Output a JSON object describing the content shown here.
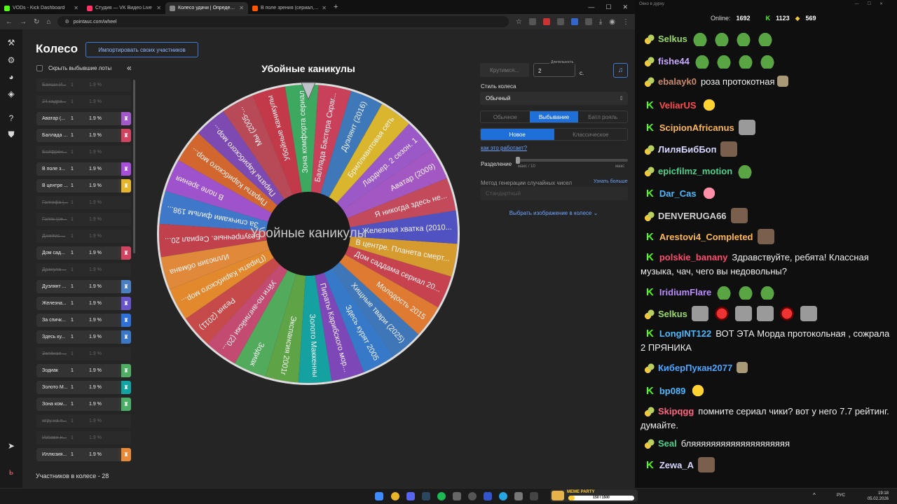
{
  "browser": {
    "tabs": [
      {
        "title": "VODs - Kick Dashboard",
        "color": "#53fc18",
        "active": false
      },
      {
        "title": "Студия — VK Видео Live",
        "color": "#ff3366",
        "active": false
      },
      {
        "title": "Колесо удачи | Определите п",
        "color": "#555555",
        "active": true
      },
      {
        "title": "В поле зрения (сериал, 1-5 се",
        "color": "#ff5500",
        "active": false
      }
    ],
    "new_tab": "+",
    "url": "pointauc.com/wheel"
  },
  "page": {
    "title": "Колесо",
    "import_label": "Импортировать своих участников",
    "hide_label": "Скрыть выбывшие лоты",
    "collapse_icon": "«",
    "count_label": "Участников в колесе - 28",
    "lots": [
      {
        "name": "Банши И...",
        "amount": "1",
        "percent": "1.9 %",
        "out": true,
        "color": ""
      },
      {
        "name": "24 кадра...",
        "amount": "1",
        "percent": "1.9 %",
        "out": true,
        "color": ""
      },
      {
        "name": "Аватар (...",
        "amount": "1",
        "percent": "1.9 %",
        "out": false,
        "color": "#a459c9"
      },
      {
        "name": "Баллада ...",
        "amount": "1",
        "percent": "1.9 %",
        "out": false,
        "color": "#d0445f"
      },
      {
        "name": "Бойфрен...",
        "amount": "1",
        "percent": "1.9 %",
        "out": true,
        "color": ""
      },
      {
        "name": "В поле з...",
        "amount": "1",
        "percent": "1.9 %",
        "out": false,
        "color": "#a64fd8"
      },
      {
        "name": "В центре ...",
        "amount": "1",
        "percent": "1.9 %",
        "out": false,
        "color": "#e5b52c"
      },
      {
        "name": "Голгофа (...",
        "amount": "1",
        "percent": "1.9 %",
        "out": true,
        "color": ""
      },
      {
        "name": "Голяк (се...",
        "amount": "1",
        "percent": "1.9 %",
        "out": true,
        "color": ""
      },
      {
        "name": "Джеймс ...",
        "amount": "1",
        "percent": "1.9 %",
        "out": true,
        "color": ""
      },
      {
        "name": "Дом сад...",
        "amount": "1",
        "percent": "1.9 %",
        "out": false,
        "color": "#d0445f"
      },
      {
        "name": "Дракула ...",
        "amount": "1",
        "percent": "1.9 %",
        "out": true,
        "color": ""
      },
      {
        "name": "Дуэлянт ...",
        "amount": "1",
        "percent": "1.9 %",
        "out": false,
        "color": "#4a7fc0"
      },
      {
        "name": "Железна...",
        "amount": "1",
        "percent": "1.9 %",
        "out": false,
        "color": "#6a54c9"
      },
      {
        "name": "За спичк...",
        "amount": "1",
        "percent": "1.9 %",
        "out": false,
        "color": "#2f6fd8"
      },
      {
        "name": "Здесь ку...",
        "amount": "1",
        "percent": "1.9 %",
        "out": false,
        "color": "#3a77c4"
      },
      {
        "name": "Зелёная ...",
        "amount": "1",
        "percent": "1.9 %",
        "out": true,
        "color": ""
      },
      {
        "name": "Зодиак",
        "amount": "1",
        "percent": "1.9 %",
        "out": false,
        "color": "#4fae63"
      },
      {
        "name": "Золото М...",
        "amount": "1",
        "percent": "1.9 %",
        "out": false,
        "color": "#13a3a1"
      },
      {
        "name": "Зона ком...",
        "amount": "1",
        "percent": "1.9 %",
        "out": false,
        "color": "#4caf68"
      },
      {
        "name": "игру на п...",
        "amount": "1",
        "percent": "1.9 %",
        "out": true,
        "color": ""
      },
      {
        "name": "Избави н...",
        "amount": "1",
        "percent": "1.9 %",
        "out": true,
        "color": ""
      },
      {
        "name": "Иллюзия...",
        "amount": "1",
        "percent": "1.9 %",
        "out": false,
        "color": "#e88a3a"
      }
    ]
  },
  "wheel": {
    "title": "Убойные каникулы",
    "center_text": "Убойные каникулы",
    "segments": [
      {
        "label": "Зона комфорта сериал",
        "color": "#3ca860"
      },
      {
        "label": "Баллада Бастера Скраг...",
        "color": "#c9405a"
      },
      {
        "label": "Дуэлянт (2016)",
        "color": "#3e78b8"
      },
      {
        "label": "Бриллиантовая сеть",
        "color": "#d9b62d"
      },
      {
        "label": "Ларднер. 2 сезон. 1",
        "color": "#9b58c7"
      },
      {
        "label": "Аватар (2009)",
        "color": "#a257c2"
      },
      {
        "label": "Я никогда здесь не...",
        "color": "#c34a5a"
      },
      {
        "label": "Железная хватка (2010...",
        "color": "#5152c2"
      },
      {
        "label": "В центре. Планета смерт...",
        "color": "#d59b2e"
      },
      {
        "label": "Дом саддама сериал 20...",
        "color": "#c6424e"
      },
      {
        "label": "Молодость 2015",
        "color": "#de7a32"
      },
      {
        "label": "Хищные твари (2025)",
        "color": "#3f76b8"
      },
      {
        "label": "Здесь курят 2005",
        "color": "#3579c8"
      },
      {
        "label": "Пираты Карибского мор...",
        "color": "#7d47b8"
      },
      {
        "label": "Золото Маккенны",
        "color": "#14a19f"
      },
      {
        "label": "Экспансия 2001г",
        "color": "#5ea447"
      },
      {
        "label": "Зодиак",
        "color": "#52aa5c"
      },
      {
        "label": "Уйти по-английски (20...",
        "color": "#c34a70"
      },
      {
        "label": "Резня (2011)",
        "color": "#c64a4a"
      },
      {
        "label": "(Пираты Карибского мор...",
        "color": "#e2892e"
      },
      {
        "label": "Иллюзия обмана",
        "color": "#e0893a"
      },
      {
        "label": "Безупречные. Сериал 20...",
        "color": "#c0404c"
      },
      {
        "label": "За спичками фильм 198...",
        "color": "#3f78c8"
      },
      {
        "label": "В поле зрения",
        "color": "#9e52cc"
      },
      {
        "label": "Пираты Карибского мор...",
        "color": "#d1672f"
      },
      {
        "label": "Пираты Карибского мор...",
        "color": "#7c4ab0"
      },
      {
        "label": "Мы (2005-...",
        "color": "#b84a58"
      },
      {
        "label": "Убойные каникулы",
        "color": "#c23a4a"
      }
    ]
  },
  "controls": {
    "spin_label": "Крутимся...",
    "duration_label": "Длительность",
    "duration_value": "2",
    "duration_unit": "с.",
    "music_icon": "♫",
    "style_label": "Стиль колеса",
    "style_value": "Обычный",
    "modes": [
      "Обычное",
      "Выбывание",
      "Батл рояль"
    ],
    "active_mode": 1,
    "variants": [
      "Новое",
      "Классическое"
    ],
    "active_variant": 0,
    "how_link": "как это работает?",
    "split_label": "Разделение",
    "split_min": "макс / 10",
    "split_max": "макс",
    "rng_label": "Метод генерации случайных чисел",
    "rng_link": "Узнать больше",
    "rng_value": "Стандартный",
    "image_link": "Выбрать изображение в колесе"
  },
  "taskbar": {
    "meme_title": "MEME PARTY",
    "meme_progress": "150 / 1500",
    "meme_fraction": 0.1,
    "lang": "РУС",
    "time": "19:18",
    "date": "05.02.2026"
  },
  "chat": {
    "window_title": "Окно в дурку",
    "online_label": "Online:",
    "online_value": "1692",
    "kick_count": "1123",
    "vk_count": "569",
    "messages": [
      {
        "badge": "pepe",
        "user": "Selkus",
        "color": "#9bd96a",
        "text": "",
        "emotes": [
          "frog",
          "frog",
          "frog",
          "frog"
        ]
      },
      {
        "badge": "pepe",
        "user": "fishe44",
        "color": "#c9a9ff",
        "text": "",
        "emotes": [
          "frog",
          "frog",
          "frog",
          "frog"
        ]
      },
      {
        "badge": "pepe",
        "user": "ebalayk0",
        "color": "#c98a6a",
        "text": "роза протокотная",
        "emotes": [
          "small"
        ]
      },
      {
        "badge": "kick",
        "user": "VeliarUS",
        "color": "#ff4d4d",
        "text": "",
        "emotes": [
          "yel"
        ]
      },
      {
        "badge": "kick",
        "user": "ScipionAfricanus",
        "color": "#ffb84d",
        "text": "",
        "emotes": [
          "gray"
        ]
      },
      {
        "badge": "pepe",
        "user": "ЛиляБибБоп",
        "color": "#d6d6ff",
        "text": "",
        "emotes": [
          "face"
        ]
      },
      {
        "badge": "pepe",
        "user": "epicfilmz_motion",
        "color": "#4fd18b",
        "text": "",
        "emotes": [
          "frog"
        ]
      },
      {
        "badge": "kick",
        "user": "Dar_Cas",
        "color": "#4db8ff",
        "text": "",
        "emotes": [
          "pink"
        ]
      },
      {
        "badge": "pepe",
        "user": "DENVERUGA66",
        "color": "#cfcfcf",
        "text": "",
        "emotes": [
          "face"
        ]
      },
      {
        "badge": "kick",
        "user": "Arestovi4_Completed",
        "color": "#ffb84d",
        "text": "",
        "emotes": [
          "face"
        ]
      },
      {
        "badge": "kick",
        "user": "polskie_banany",
        "color": "#ff4d6d",
        "text": "Здравствуйте, ребята! Классная музыка, чач, чего вы недовольны?",
        "emotes": []
      },
      {
        "badge": "kick",
        "user": "IridiumFlare",
        "color": "#b98cff",
        "text": "",
        "emotes": [
          "frog",
          "frog",
          "frog"
        ]
      },
      {
        "badge": "pepe",
        "user": "Selkus",
        "color": "#9bd96a",
        "text": "",
        "emotes": [
          "gray",
          "red",
          "gray",
          "gray",
          "red",
          "gray"
        ]
      },
      {
        "badge": "kick",
        "user": "LongINT122",
        "color": "#4db8ff",
        "text": "ВОТ ЭТА Морда протокольная , сожрала 2 ПРЯНИКА",
        "emotes": []
      },
      {
        "badge": "pepe",
        "user": "КиберПукан2077",
        "color": "#4da6ff",
        "text": "",
        "emotes": [
          "small"
        ]
      },
      {
        "badge": "kick",
        "user": "bp089",
        "color": "#4db8ff",
        "text": "",
        "emotes": [
          "yel"
        ]
      },
      {
        "badge": "pepe",
        "user": "Skipqgg",
        "color": "#ff6680",
        "text": "помните сериал чики? вот у него 7.7 рейтинг. думайте.",
        "emotes": []
      },
      {
        "badge": "pepe",
        "user": "Seal",
        "color": "#4fd18b",
        "text": "бляяяяяяяяяяяяяяяяяяяя",
        "emotes": []
      },
      {
        "badge": "kick",
        "user": "Zewa_A",
        "color": "#d6d6ff",
        "text": "",
        "emotes": [
          "face"
        ]
      }
    ]
  }
}
